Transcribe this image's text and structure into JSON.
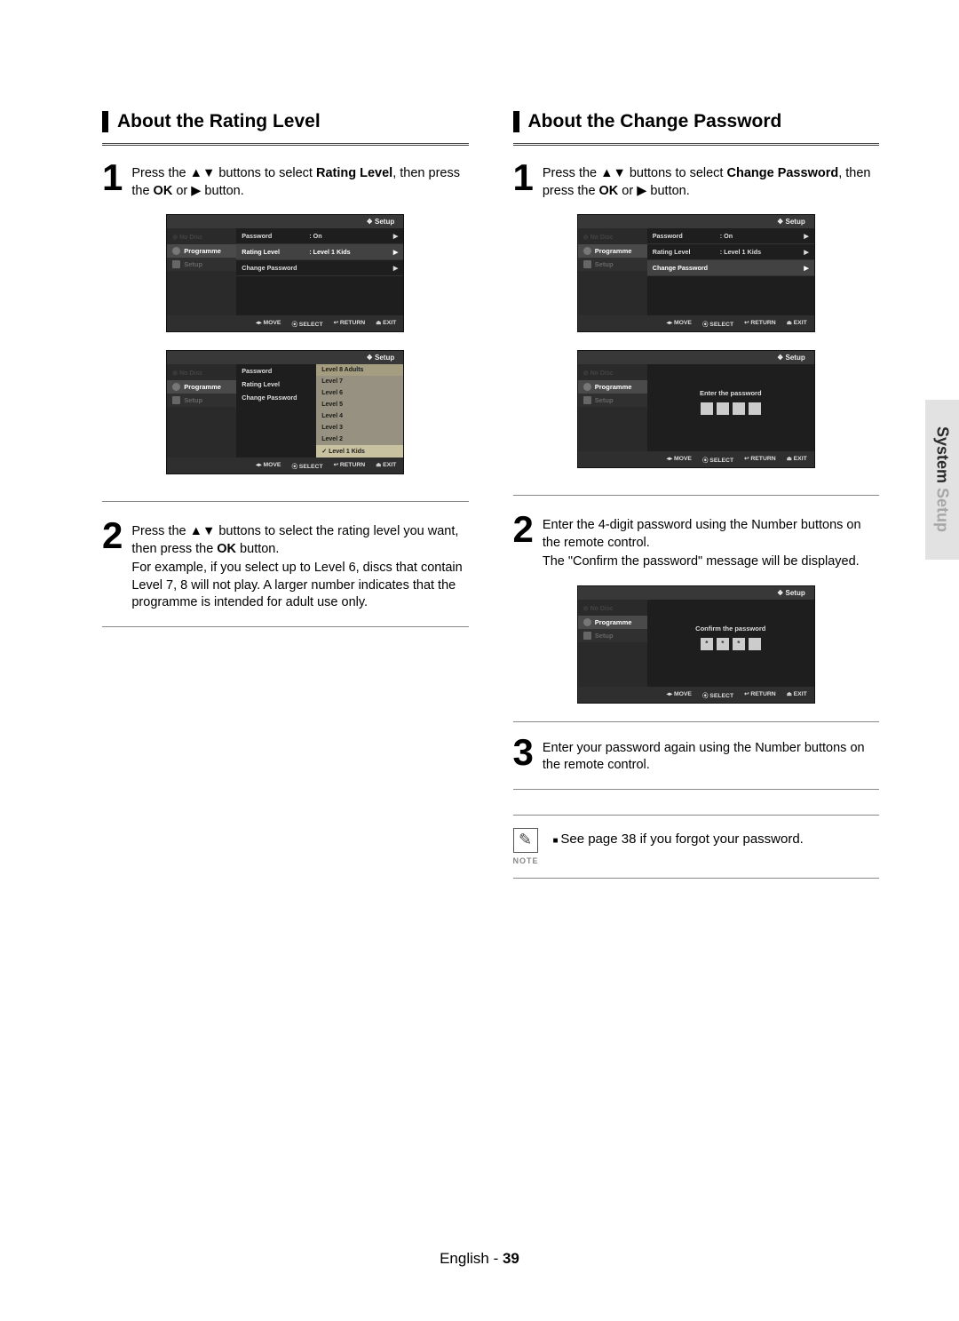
{
  "side_tab": {
    "part1": "System ",
    "part2": "Setup"
  },
  "footer": {
    "lang": "English",
    "sep": " - ",
    "page": "39"
  },
  "left": {
    "heading": "About the Rating Level",
    "step1_num": "1",
    "step1_a": "Press the ",
    "step1_b": " buttons to select ",
    "step1_bold": "Rating Level",
    "step1_c": ", then press the ",
    "step1_ok": "OK",
    "step1_d": " or ",
    "step1_e": " button.",
    "step2_num": "2",
    "step2_a": "Press the ",
    "step2_b": " buttons to select the rating level you want, then press the ",
    "step2_ok": "OK",
    "step2_c": " button.",
    "step2_sub": "For example, if you select up to Level 6, discs that contain Level 7, 8 will not play. A larger number indicates that the programme is intended for adult use only.",
    "osd1": {
      "title": "Setup",
      "nodisc": "No Disc",
      "side_prog": "Programme",
      "side_setup": "Setup",
      "rows": [
        {
          "label": "Password",
          "value": ": On",
          "arrow": "▶"
        },
        {
          "label": "Rating Level",
          "value": ": Level 1 Kids",
          "arrow": "▶",
          "hl": true
        },
        {
          "label": "Change Password",
          "value": "",
          "arrow": "▶"
        }
      ],
      "foot_move": "MOVE",
      "foot_sel": "SELECT",
      "foot_ret": "RETURN",
      "foot_exit": "EXIT"
    },
    "osd2": {
      "title": "Setup",
      "nodisc": "No Disc",
      "side_prog": "Programme",
      "side_setup": "Setup",
      "mainrows": [
        {
          "label": "Password",
          "value": ""
        },
        {
          "label": "Rating Level",
          "value": ""
        },
        {
          "label": "Change Password",
          "value": ""
        }
      ],
      "levels": [
        "Level 8 Adults",
        "Level 7",
        "Level 6",
        "Level 5",
        "Level 4",
        "Level 3",
        "Level 2",
        "Level 1 Kids"
      ],
      "foot_move": "MOVE",
      "foot_sel": "SELECT",
      "foot_ret": "RETURN",
      "foot_exit": "EXIT"
    }
  },
  "right": {
    "heading": "About the Change Password",
    "step1_num": "1",
    "step1_a": "Press the ",
    "step1_b": " buttons to select ",
    "step1_bold": "Change Password",
    "step1_c": ", then press the ",
    "step1_ok": "OK",
    "step1_d": " or ",
    "step1_e": " button.",
    "osd1": {
      "title": "Setup",
      "nodisc": "No Disc",
      "side_prog": "Programme",
      "side_setup": "Setup",
      "rows": [
        {
          "label": "Password",
          "value": ": On",
          "arrow": "▶"
        },
        {
          "label": "Rating Level",
          "value": ": Level 1 Kids",
          "arrow": "▶"
        },
        {
          "label": "Change Password",
          "value": "",
          "arrow": "▶",
          "hl": true
        }
      ],
      "foot_move": "MOVE",
      "foot_sel": "SELECT",
      "foot_ret": "RETURN",
      "foot_exit": "EXIT"
    },
    "osd2": {
      "title": "Setup",
      "nodisc": "No Disc",
      "side_prog": "Programme",
      "side_setup": "Setup",
      "prompt": "Enter the password",
      "vals": [
        "",
        "",
        "",
        ""
      ],
      "foot_move": "MOVE",
      "foot_sel": "SELECT",
      "foot_ret": "RETURN",
      "foot_exit": "EXIT"
    },
    "step2_num": "2",
    "step2_a": "Enter the 4-digit password using the Number buttons on the remote control.",
    "step2_b": "The \"Confirm the password\" message will be displayed.",
    "osd3": {
      "title": "Setup",
      "nodisc": "No Disc",
      "side_prog": "Programme",
      "side_setup": "Setup",
      "prompt": "Confirm the password",
      "vals": [
        "*",
        "*",
        "*",
        ""
      ],
      "foot_move": "MOVE",
      "foot_sel": "SELECT",
      "foot_ret": "RETURN",
      "foot_exit": "EXIT"
    },
    "step3_num": "3",
    "step3_txt": "Enter your password again using the Number buttons on the remote control.",
    "note_label": "NOTE",
    "note_text": "See page 38 if you forgot your password."
  },
  "glyphs": {
    "updown": "▲▼",
    "play": "▶"
  }
}
